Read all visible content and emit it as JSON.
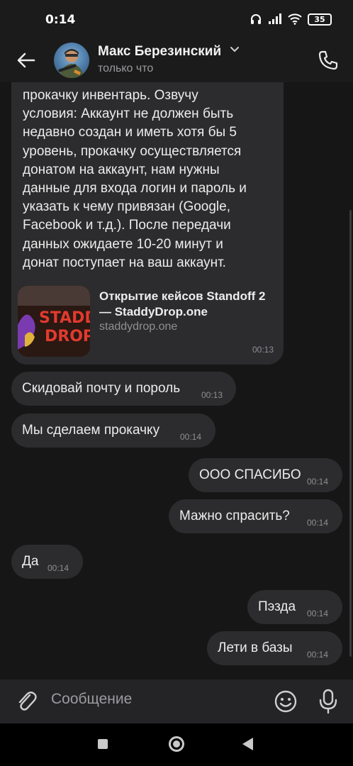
{
  "status_bar": {
    "time": "0:14",
    "battery": "35"
  },
  "header": {
    "name": "Макс Березинский",
    "status": "только что"
  },
  "chat": {
    "first_message": {
      "text": "прокачку инвентарь. Озвучу\nусловия: Аккаунт не должен быть\nнедавно создан и иметь хотя бы 5\nуровень, прокачку осуществляется\nдонатом на аккаунт, нам нужны\nданные для входа логин и пароль и\nуказать к чему привязан (Google,\nFacebook и т.д.). После передачи\nданных ожидаете 10-20 минут и\nдонат поступает на ваш аккаунт.",
      "link_title": "Открытие кейсов Standoff 2 — StaddyDrop.one",
      "link_domain": "staddydrop.one",
      "link_thumb_text": "STADDY DROP",
      "time": "00:13"
    },
    "messages": [
      {
        "side": "in",
        "text": "Скидовай почту и пороль",
        "time": "00:13"
      },
      {
        "side": "in",
        "text": "Мы сделаем прокачку",
        "time": "00:14"
      },
      {
        "side": "out",
        "text": "ООО СПАСИБО",
        "time": "00:14"
      },
      {
        "side": "out",
        "text": "Мажно спрасить?",
        "time": "00:14"
      },
      {
        "side": "in",
        "text": "Да",
        "time": "00:14"
      },
      {
        "side": "out",
        "text": "Пэзда",
        "time": "00:14"
      },
      {
        "side": "out",
        "text": "Лети в базы",
        "time": "00:14"
      }
    ]
  },
  "input": {
    "placeholder": "Сообщение"
  },
  "icons": {
    "back": "arrow-left-icon",
    "call": "phone-icon",
    "attach": "paperclip-icon",
    "emoji": "smiley-icon",
    "mic": "microphone-icon"
  },
  "colors": {
    "background": "#161616",
    "bubble": "#2c2c2e",
    "text": "#ececec",
    "time": "#8f8f93"
  }
}
